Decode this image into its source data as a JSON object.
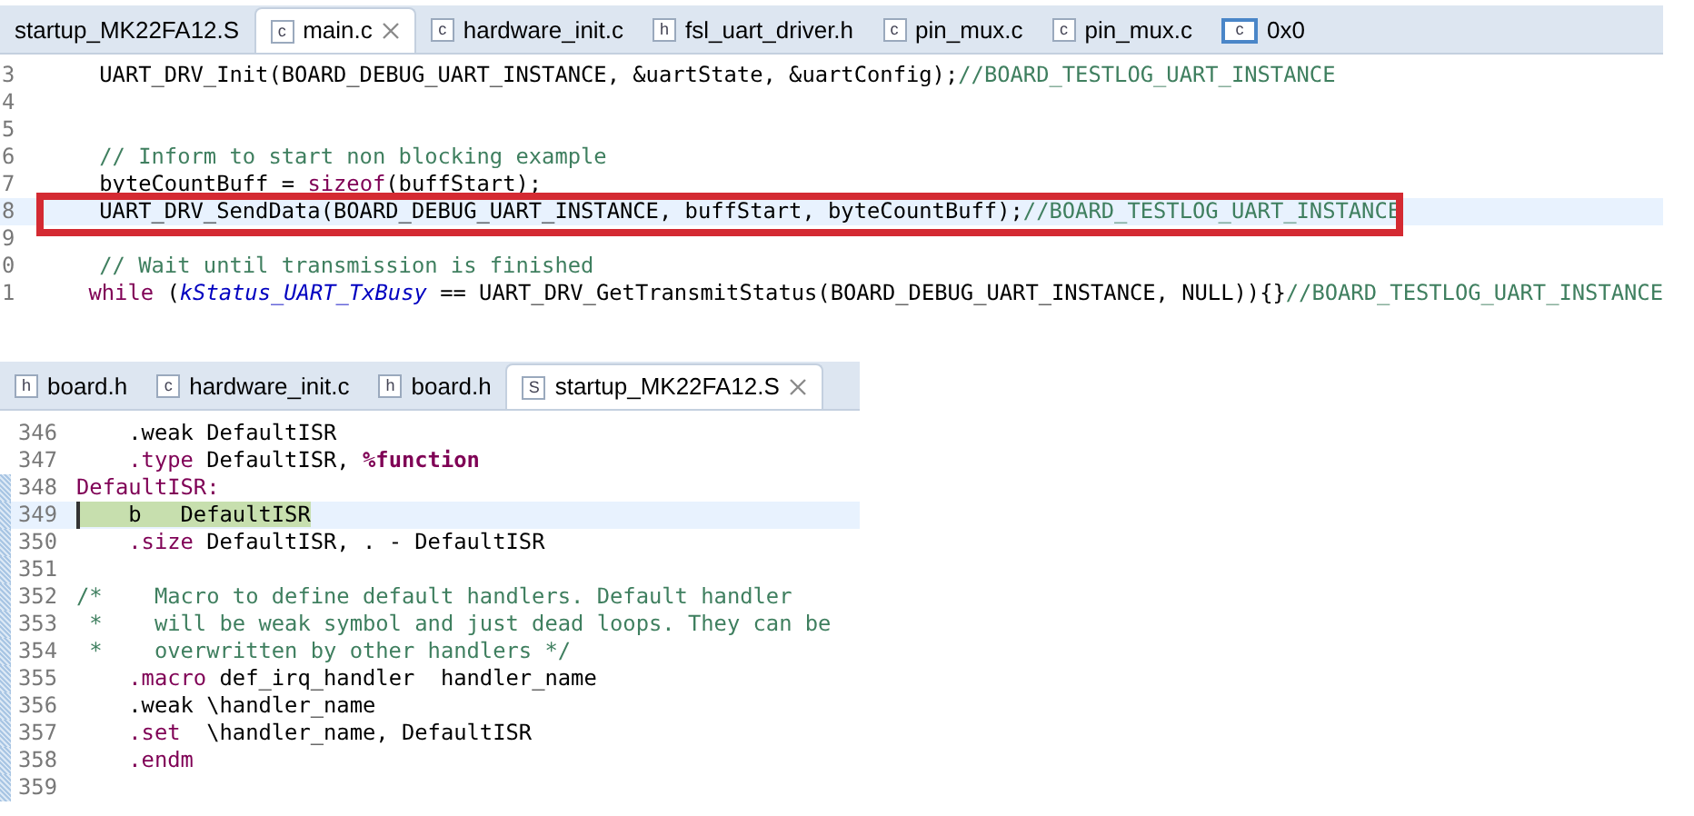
{
  "top_editor": {
    "tabs": [
      {
        "label": "startup_MK22FA12.S",
        "selected": false
      },
      {
        "label": "main.c",
        "icon": "c",
        "kind": "file",
        "selected": true
      },
      {
        "label": "hardware_init.c",
        "icon": "c",
        "kind": "file",
        "selected": false
      },
      {
        "label": "fsl_uart_driver.h",
        "icon": "h",
        "kind": "file",
        "selected": false
      },
      {
        "label": "pin_mux.c",
        "icon": "c",
        "kind": "file",
        "selected": false
      },
      {
        "label": "pin_mux.c",
        "icon": "c",
        "kind": "file",
        "selected": false
      },
      {
        "label": "0x0",
        "icon": "c",
        "kind": "address",
        "selected": false
      }
    ],
    "lines": [
      {
        "number": "3",
        "current": false,
        "boxed": false,
        "segments": [
          {
            "kind": "code",
            "text": "    UART_DRV_Init(BOARD_DEBUG_UART_INSTANCE, &uartState, &uartConfig);"
          },
          {
            "kind": "comment",
            "text": "//BOARD_TESTLOG_UART_INSTANCE"
          }
        ]
      },
      {
        "number": "4",
        "current": false,
        "boxed": false
      },
      {
        "number": "5",
        "current": false,
        "boxed": false
      },
      {
        "number": "6",
        "current": false,
        "boxed": false,
        "segments": [
          {
            "kind": "comment",
            "text": "    // Inform to start non blocking example"
          }
        ]
      },
      {
        "number": "7",
        "current": false,
        "boxed": false,
        "segments": [
          {
            "kind": "code",
            "text": "    byteCountBuff = "
          },
          {
            "kind": "keyword",
            "text": "sizeof"
          },
          {
            "kind": "code",
            "text": "(buffStart);"
          }
        ]
      },
      {
        "number": "8",
        "current": true,
        "boxed": true,
        "segments": [
          {
            "kind": "code",
            "text": "    UART_DRV_SendData(BOARD_DEBUG_UART_INSTANCE, buffStart, byteCountBuff);"
          },
          {
            "kind": "comment",
            "text": "//BOARD_TESTLOG_UART_INSTANCE"
          }
        ]
      },
      {
        "number": "9",
        "current": false,
        "boxed": false
      },
      {
        "number": "0",
        "current": false,
        "boxed": false,
        "segments": [
          {
            "kind": "comment",
            "text": "    // Wait until transmission is finished"
          }
        ]
      },
      {
        "number": "1",
        "current": false,
        "boxed": false,
        "segments": [
          {
            "kind": "keyword",
            "text": "    while"
          },
          {
            "kind": "code",
            "text": " ("
          },
          {
            "kind": "constant",
            "text": "kStatus_UART_TxBusy"
          },
          {
            "kind": "code",
            "text": " == UART_DRV_GetTransmitStatus(BOARD_DEBUG_UART_INSTANCE, NULL)){}"
          },
          {
            "kind": "comment",
            "text": "//BOARD_TESTLOG_UART_INSTANCE"
          }
        ]
      }
    ]
  },
  "bottom_editor": {
    "tabs": [
      {
        "label": "board.h",
        "icon": "h",
        "kind": "file",
        "selected": false
      },
      {
        "label": "hardware_init.c",
        "icon": "c",
        "kind": "file",
        "selected": false
      },
      {
        "label": "board.h",
        "icon": "h",
        "kind": "file",
        "selected": false
      },
      {
        "label": "startup_MK22FA12.S",
        "icon": "S",
        "kind": "file",
        "selected": true
      }
    ],
    "lines": [
      {
        "number": "346",
        "current": false,
        "marked": false,
        "segments": [
          {
            "kind": "code",
            "text": "    .weak DefaultISR"
          }
        ]
      },
      {
        "number": "347",
        "current": false,
        "marked": false,
        "segments": [
          {
            "kind": "keyword",
            "text": "    .type"
          },
          {
            "kind": "code",
            "text": " DefaultISR, "
          },
          {
            "kind": "strong",
            "text": "%function"
          }
        ]
      },
      {
        "number": "348",
        "current": false,
        "marked": true,
        "segments": [
          {
            "kind": "keyword",
            "text": "DefaultISR:"
          }
        ]
      },
      {
        "number": "349",
        "current": true,
        "marked": true,
        "segments": [
          {
            "kind": "selected",
            "text": "    b   DefaultISR"
          }
        ]
      },
      {
        "number": "350",
        "current": false,
        "marked": true,
        "segments": [
          {
            "kind": "keyword",
            "text": "    .size"
          },
          {
            "kind": "code",
            "text": " DefaultISR, . - DefaultISR"
          }
        ]
      },
      {
        "number": "351",
        "current": false,
        "marked": true
      },
      {
        "number": "352",
        "current": false,
        "marked": true,
        "segments": [
          {
            "kind": "comment",
            "text": "/*    Macro to define default handlers. Default handler"
          }
        ]
      },
      {
        "number": "353",
        "current": false,
        "marked": true,
        "segments": [
          {
            "kind": "comment",
            "text": " *    will be weak symbol and just dead loops. They can be"
          }
        ]
      },
      {
        "number": "354",
        "current": false,
        "marked": true,
        "segments": [
          {
            "kind": "comment",
            "text": " *    overwritten by other handlers */"
          }
        ]
      },
      {
        "number": "355",
        "current": false,
        "marked": true,
        "segments": [
          {
            "kind": "keyword",
            "text": "    .macro"
          },
          {
            "kind": "code",
            "text": " def_irq_handler  handler_name"
          }
        ]
      },
      {
        "number": "356",
        "current": false,
        "marked": true,
        "segments": [
          {
            "kind": "code",
            "text": "    .weak \\handler_name"
          }
        ]
      },
      {
        "number": "357",
        "current": false,
        "marked": true,
        "segments": [
          {
            "kind": "keyword",
            "text": "    .set"
          },
          {
            "kind": "code",
            "text": "  \\handler_name, DefaultISR"
          }
        ]
      },
      {
        "number": "358",
        "current": false,
        "marked": true,
        "segments": [
          {
            "kind": "keyword",
            "text": "    .endm"
          }
        ]
      },
      {
        "number": "359",
        "current": false,
        "marked": true
      }
    ]
  }
}
